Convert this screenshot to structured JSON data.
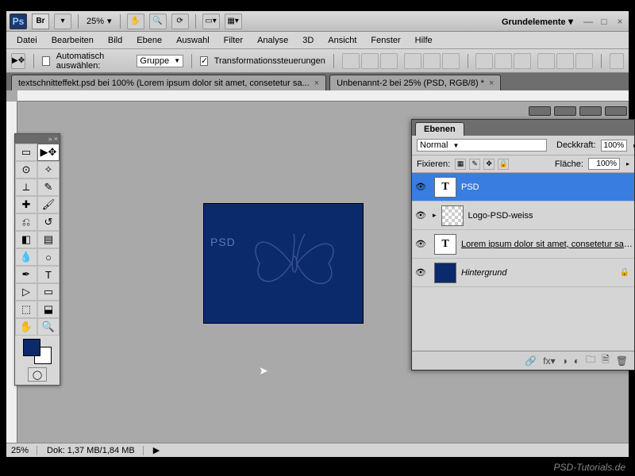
{
  "topbar": {
    "zoom": "25%",
    "workspace": "Grundelemente"
  },
  "menu": [
    "Datei",
    "Bearbeiten",
    "Bild",
    "Ebene",
    "Auswahl",
    "Filter",
    "Analyse",
    "3D",
    "Ansicht",
    "Fenster",
    "Hilfe"
  ],
  "options": {
    "auto_select": "Automatisch auswählen:",
    "group": "Gruppe",
    "transform": "Transformationssteuerungen"
  },
  "tabs": [
    {
      "label": "textschnitteffekt.psd bei 100% (Lorem ipsum dolor sit amet, consetetur sa...",
      "close": "×"
    },
    {
      "label": "Unbenannt-2 bei 25% (PSD, RGB/8) *",
      "close": "×"
    }
  ],
  "status": {
    "zoom": "25%",
    "doc": "Dok: 1,37 MB/1,84 MB"
  },
  "layers_panel": {
    "title": "Ebenen",
    "blend": "Normal",
    "opacity_label": "Deckkraft:",
    "opacity": "100%",
    "lock_label": "Fixieren:",
    "fill_label": "Fläche:",
    "fill": "100%",
    "layers": [
      {
        "name": "PSD",
        "type": "T",
        "sel": true
      },
      {
        "name": "Logo-PSD-weiss",
        "type": "checker"
      },
      {
        "name": "Lorem ipsum dolor sit amet, consetetur sadips...",
        "type": "T",
        "underline": true
      },
      {
        "name": "Hintergrund",
        "type": "bg",
        "italic": true,
        "locked": true
      }
    ]
  },
  "canvas": {
    "text": "PSD"
  },
  "watermark": "PSD-Tutorials.de"
}
